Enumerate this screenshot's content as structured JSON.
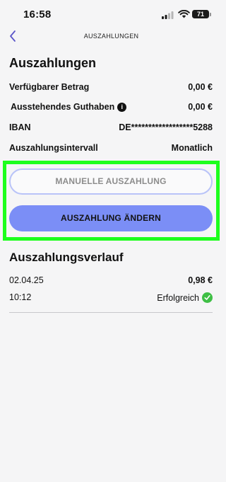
{
  "status_bar": {
    "time": "16:58",
    "battery": "71"
  },
  "nav": {
    "title": "AUSZAHLUNGEN"
  },
  "page": {
    "title": "Auszahlungen"
  },
  "rows": [
    {
      "label": "Verfügbarer Betrag",
      "value": "0,00 €"
    },
    {
      "label": "Ausstehendes Guthaben",
      "value": "0,00 €"
    },
    {
      "label": "IBAN",
      "value": "DE******************5288"
    },
    {
      "label": "Auszahlungsintervall",
      "value": "Monatlich"
    }
  ],
  "buttons": {
    "manual": "MANUELLE AUSZAHLUNG",
    "change": "AUSZAHLUNG ÄNDERN"
  },
  "history": {
    "title": "Auszahlungsverlauf",
    "items": [
      {
        "date": "02.04.25",
        "amount": "0,98 €",
        "time": "10:12",
        "status": "Erfolgreich"
      }
    ]
  },
  "colors": {
    "accent": "#7b8ef6",
    "highlight": "#1dff1d",
    "success": "#3fbf45",
    "back_arrow": "#5a55c9"
  },
  "icons": {
    "back": "chevron-left-icon",
    "info": "info-icon",
    "success": "check-circle-icon"
  }
}
